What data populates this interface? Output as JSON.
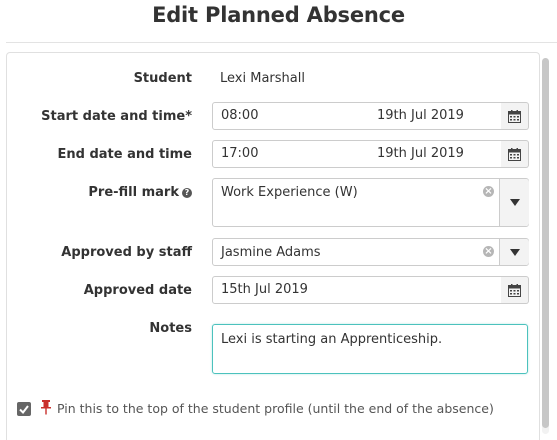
{
  "dialog": {
    "title": "Edit Planned Absence"
  },
  "form": {
    "student": {
      "label": "Student",
      "value": "Lexi Marshall"
    },
    "start": {
      "label": "Start date and time*",
      "time": "08:00",
      "date": "19th Jul 2019"
    },
    "end": {
      "label": "End date and time",
      "time": "17:00",
      "date": "19th Jul 2019"
    },
    "prefill": {
      "label": "Pre-fill mark",
      "value": "Work Experience (W)",
      "help_icon": "question-circle-icon"
    },
    "approved_by": {
      "label": "Approved by staff",
      "value": "Jasmine Adams"
    },
    "approved_date": {
      "label": "Approved date",
      "value": "15th Jul 2019"
    },
    "notes": {
      "label": "Notes",
      "value": "Lexi is starting an Apprenticeship."
    },
    "pin": {
      "checked": true,
      "label": "Pin this to the top of the student profile (until the end of the absence)",
      "icon": "pin-icon"
    }
  },
  "colors": {
    "focus_border": "#4cc2bd",
    "pin_icon": "#c9302c",
    "checkbox": "#666666"
  }
}
